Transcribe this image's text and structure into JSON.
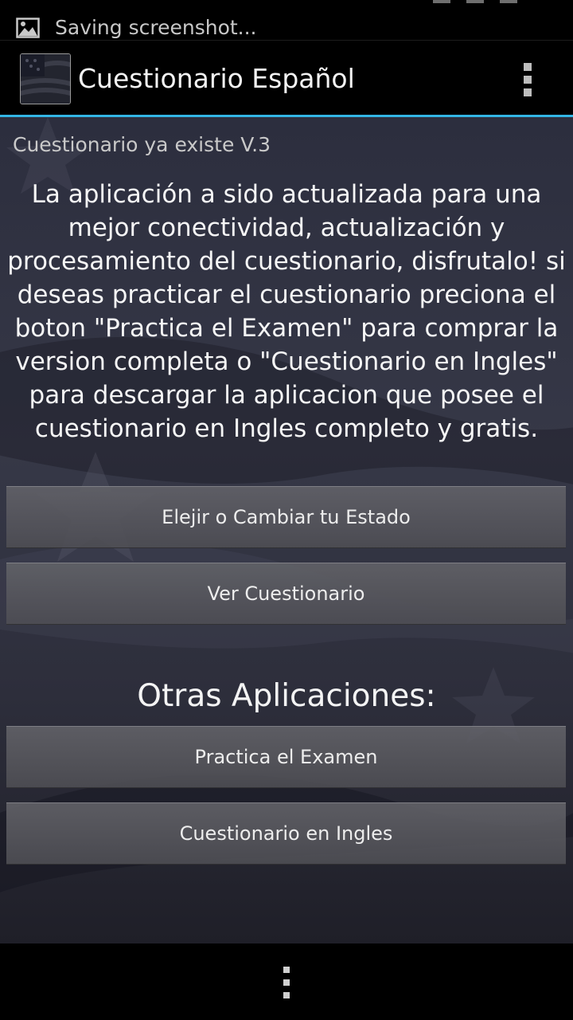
{
  "status_bar": {
    "notification_text": "Saving screenshot...",
    "notification_icon": "image-icon"
  },
  "action_bar": {
    "title": "Cuestionario Español",
    "app_icon": "flag-icon",
    "menu_icon": "overflow-menu-icon"
  },
  "main": {
    "version_text": "Cuestionario ya existe V.3",
    "info_lines": [
      "La aplicación a sido actualizada para una",
      "mejor conectividad, actualización y",
      "procesamiento del cuestionario, disfrutalo! si",
      "deseas practicar el cuestionario preciona el",
      "boton \"Practica el Examen\" para comprar la",
      "version completa o \"Cuestionario en Ingles\"",
      "para descargar la aplicacion que posee el",
      "cuestionario en Ingles completo y gratis."
    ],
    "buttons": {
      "choose_state": "Elejir o Cambiar tu Estado",
      "view_questionnaire": "Ver Cuestionario"
    },
    "other_apps": {
      "heading": "Otras Aplicaciones:",
      "practice_exam": "Practica el Examen",
      "english_questionnaire": "Cuestionario en Ingles"
    }
  },
  "nav_bar": {
    "menu_icon": "menu-dots-icon"
  },
  "colors": {
    "accent": "#33b5e5",
    "background": "#000000",
    "button": "#58585e",
    "text": "#f4f4f4"
  }
}
